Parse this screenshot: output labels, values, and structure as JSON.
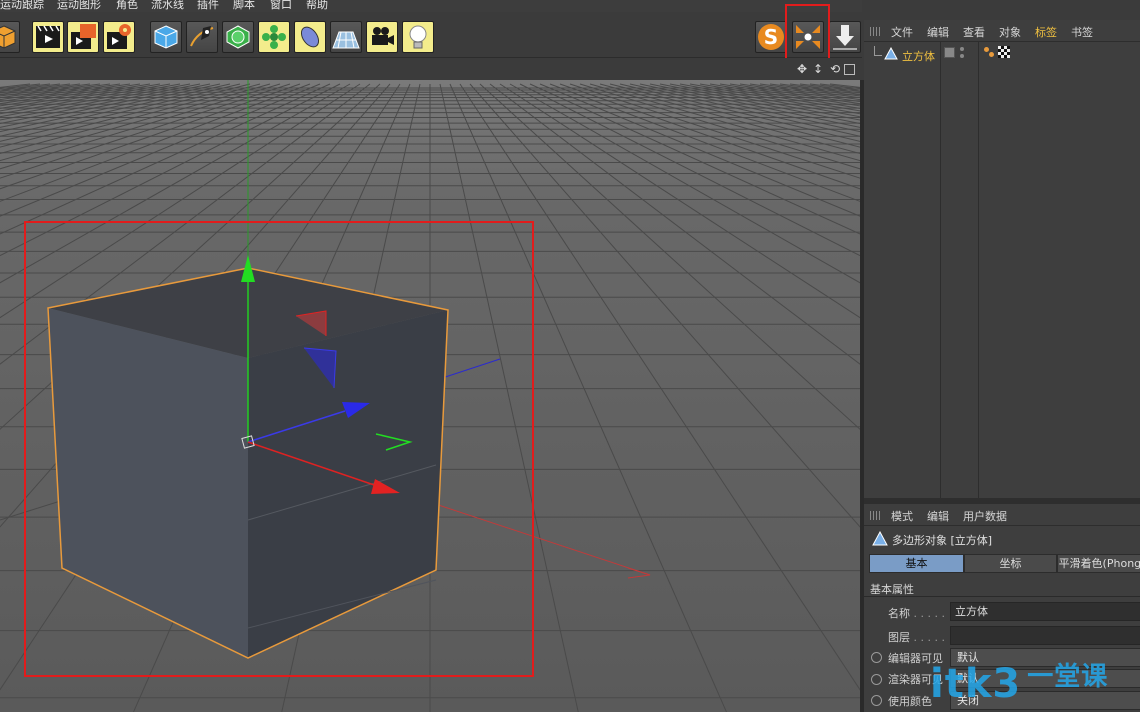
{
  "menu": [
    "运动跟踪",
    "运动图形",
    "角色",
    "流水线",
    "插件",
    "脚本",
    "窗口",
    "帮助"
  ],
  "toolbar": {
    "buttons": [
      {
        "name": "cube-object-icon",
        "hl": false
      },
      {
        "name": "render-view-icon",
        "hl": true
      },
      {
        "name": "render-to-picture-viewer-icon",
        "hl": true
      },
      {
        "name": "render-settings-icon",
        "hl": true
      },
      {
        "name": "cube-primitive-icon",
        "hl": false
      },
      {
        "name": "pen-spline-icon",
        "hl": false
      },
      {
        "name": "subdivision-surface-icon",
        "hl": false
      },
      {
        "name": "cloner-icon",
        "hl": true
      },
      {
        "name": "deformer-icon",
        "hl": true
      },
      {
        "name": "floor-environment-icon",
        "hl": false
      },
      {
        "name": "camera-icon",
        "hl": true
      },
      {
        "name": "light-icon",
        "hl": true
      }
    ],
    "right_buttons": [
      "snap-s-icon",
      "center-axis-icon",
      "drop-to-floor-icon"
    ]
  },
  "view_icons": [
    "move-view-icon",
    "dolly-view-icon",
    "rotate-view-icon",
    "maximize-view-icon"
  ],
  "object_manager": {
    "menus": [
      "文件",
      "编辑",
      "查看",
      "对象",
      "标签",
      "书签"
    ],
    "active_menu": "标签",
    "object_name": "立方体"
  },
  "attributes": {
    "menus": [
      "模式",
      "编辑",
      "用户数据"
    ],
    "title": "多边形对象 [立方体]",
    "tabs": [
      "基本",
      "坐标",
      "平滑着色(Phong)"
    ],
    "selected_tab": "基本",
    "section": "基本属性",
    "fields": {
      "name_label": "名称",
      "name_value": "立方体",
      "layer_label": "图层",
      "layer_value": "",
      "editor_visible_label": "编辑器可见",
      "editor_visible_value": "默认",
      "render_visible_label": "渲染器可见",
      "render_visible_value": "默认",
      "use_color_label": "使用颜色",
      "use_color_value": "关闭"
    }
  },
  "watermark": {
    "text": "itk3",
    "cn": "一堂课"
  },
  "colors": {
    "highlight_red": "#e21c1c",
    "selection_orange": "#e89a3c",
    "axis_green": "#22dd22",
    "axis_blue": "#2a2ae8",
    "axis_red": "#e22222"
  }
}
